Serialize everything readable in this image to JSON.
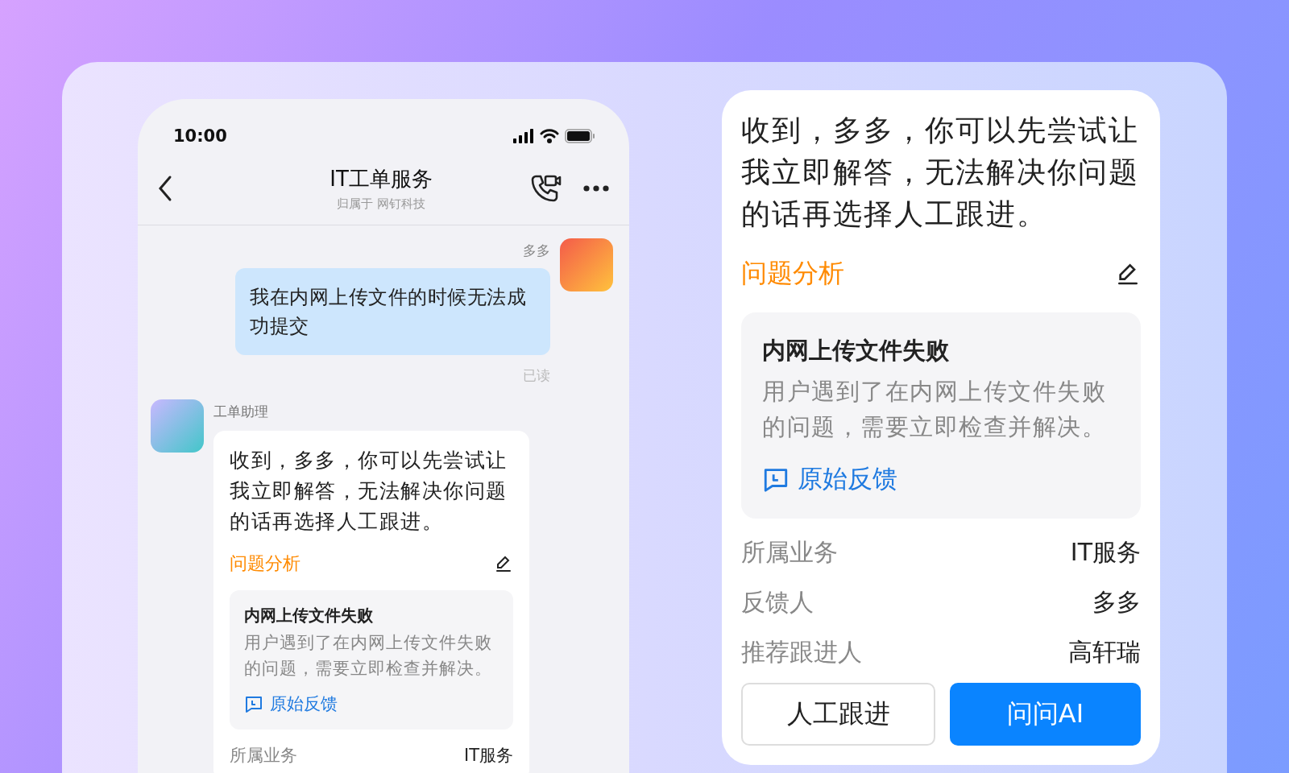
{
  "phone": {
    "status_time": "10:00",
    "title": "IT工单服务",
    "subtitle": "归属于 网钉科技",
    "user_message": {
      "sender": "多多",
      "text": "我在内网上传文件的时候无法成功提交",
      "receipt": "已读"
    },
    "bot_message": {
      "sender": "工单助理",
      "text": "收到，多多，你可以先尝试让我立即解答，无法解决你问题的话再选择人工跟进。",
      "section_title": "问题分析",
      "issue": {
        "title": "内网上传文件失败",
        "description": "用户遇到了在内网上传文件失败的问题，需要立即检查并解决。",
        "link": "原始反馈"
      },
      "fields": [
        {
          "label": "所属业务",
          "value": "IT服务"
        }
      ]
    }
  },
  "zoom_card": {
    "text": "收到，多多，你可以先尝试让我立即解答，无法解决你问题的话再选择人工跟进。",
    "section_title": "问题分析",
    "issue": {
      "title": "内网上传文件失败",
      "description": "用户遇到了在内网上传文件失败的问题，需要立即检查并解决。",
      "link": "原始反馈"
    },
    "fields": [
      {
        "label": "所属业务",
        "value": "IT服务"
      },
      {
        "label": "反馈人",
        "value": "多多"
      },
      {
        "label": "推荐跟进人",
        "value": "高轩瑞"
      }
    ],
    "buttons": [
      {
        "label": "人工跟进",
        "kind": "secondary"
      },
      {
        "label": "问问AI",
        "kind": "primary"
      }
    ]
  }
}
